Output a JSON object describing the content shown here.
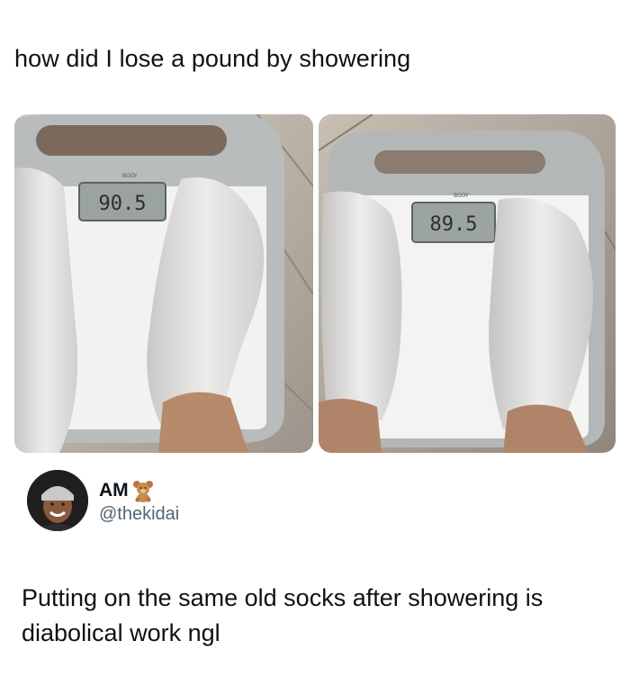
{
  "post": {
    "caption": "how did I lose a pound by showering"
  },
  "photos": [
    {
      "scale_reading": "90.5",
      "brand": "BODY"
    },
    {
      "scale_reading": "89.5",
      "brand": "BODY"
    }
  ],
  "reply": {
    "author_name": "AM",
    "author_emoji": "teddy-bear-icon",
    "handle": "@thekidai",
    "text": "Putting on the same old socks after showering is diabolical work ngl"
  }
}
